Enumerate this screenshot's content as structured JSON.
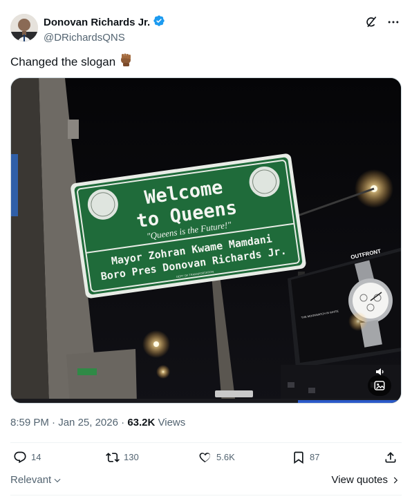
{
  "author": {
    "display_name": "Donovan Richards Jr.",
    "handle": "@DRichardsQNS",
    "verified": true,
    "verified_color": "#1d9bf0"
  },
  "header_icons": [
    "grok-icon",
    "more-icon"
  ],
  "tweet": {
    "text": "Changed the slogan",
    "emoji": "✊🏾"
  },
  "media": {
    "sign": {
      "line1": "Welcome",
      "line2": "to Queens",
      "slogan": "\"Queens is the Future!\"",
      "line3": "Mayor Zohran Kwame Mamdani",
      "line4": "Boro Pres Donovan Richards Jr.",
      "footer": "DEPT OF TRANSPORTATION",
      "color": "#1f6b3a"
    },
    "billboard": {
      "brand": "OUTFRONT",
      "tagline": "THE MOONWATCH IN WHITE"
    }
  },
  "meta": {
    "time": "8:59 PM",
    "date": "Jan 25, 2026",
    "views_count": "63.2K",
    "views_label": "Views"
  },
  "actions": {
    "replies": "14",
    "reposts": "130",
    "likes": "5.6K",
    "bookmarks": "87"
  },
  "footer": {
    "sort_label": "Relevant",
    "view_quotes_label": "View quotes"
  }
}
